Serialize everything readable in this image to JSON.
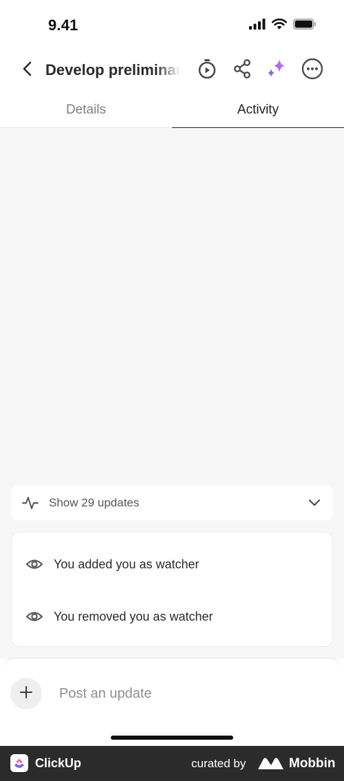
{
  "status_bar": {
    "time": "9.41",
    "icons": [
      "signal-icon",
      "wifi-icon",
      "battery-icon"
    ]
  },
  "header": {
    "title": "Develop preliminary",
    "icons": [
      "back-icon",
      "timer-icon",
      "share-icon",
      "ai-sparkle-icon",
      "more-icon"
    ]
  },
  "tabs": [
    {
      "label": "Details",
      "active": false
    },
    {
      "label": "Activity",
      "active": true
    }
  ],
  "activity": {
    "toggle_label": "Show 29 updates",
    "items": [
      {
        "icon": "eye-icon",
        "text": "You added you as watcher"
      },
      {
        "icon": "eye-icon",
        "text": "You removed you as watcher"
      }
    ]
  },
  "composer": {
    "placeholder": "Post an update",
    "value": ""
  },
  "footer": {
    "brand": "ClickUp",
    "curated_by": "curated by",
    "curator": "Mobbin"
  },
  "colors": {
    "accent_purple": "#7b68ee",
    "accent_pink": "#fd71af",
    "accent_blue": "#49ccf9",
    "text_primary": "#1f2024",
    "text_secondary": "#7d7e83",
    "background": "#f7f7f7",
    "footer_bg": "#2b2b2b"
  }
}
